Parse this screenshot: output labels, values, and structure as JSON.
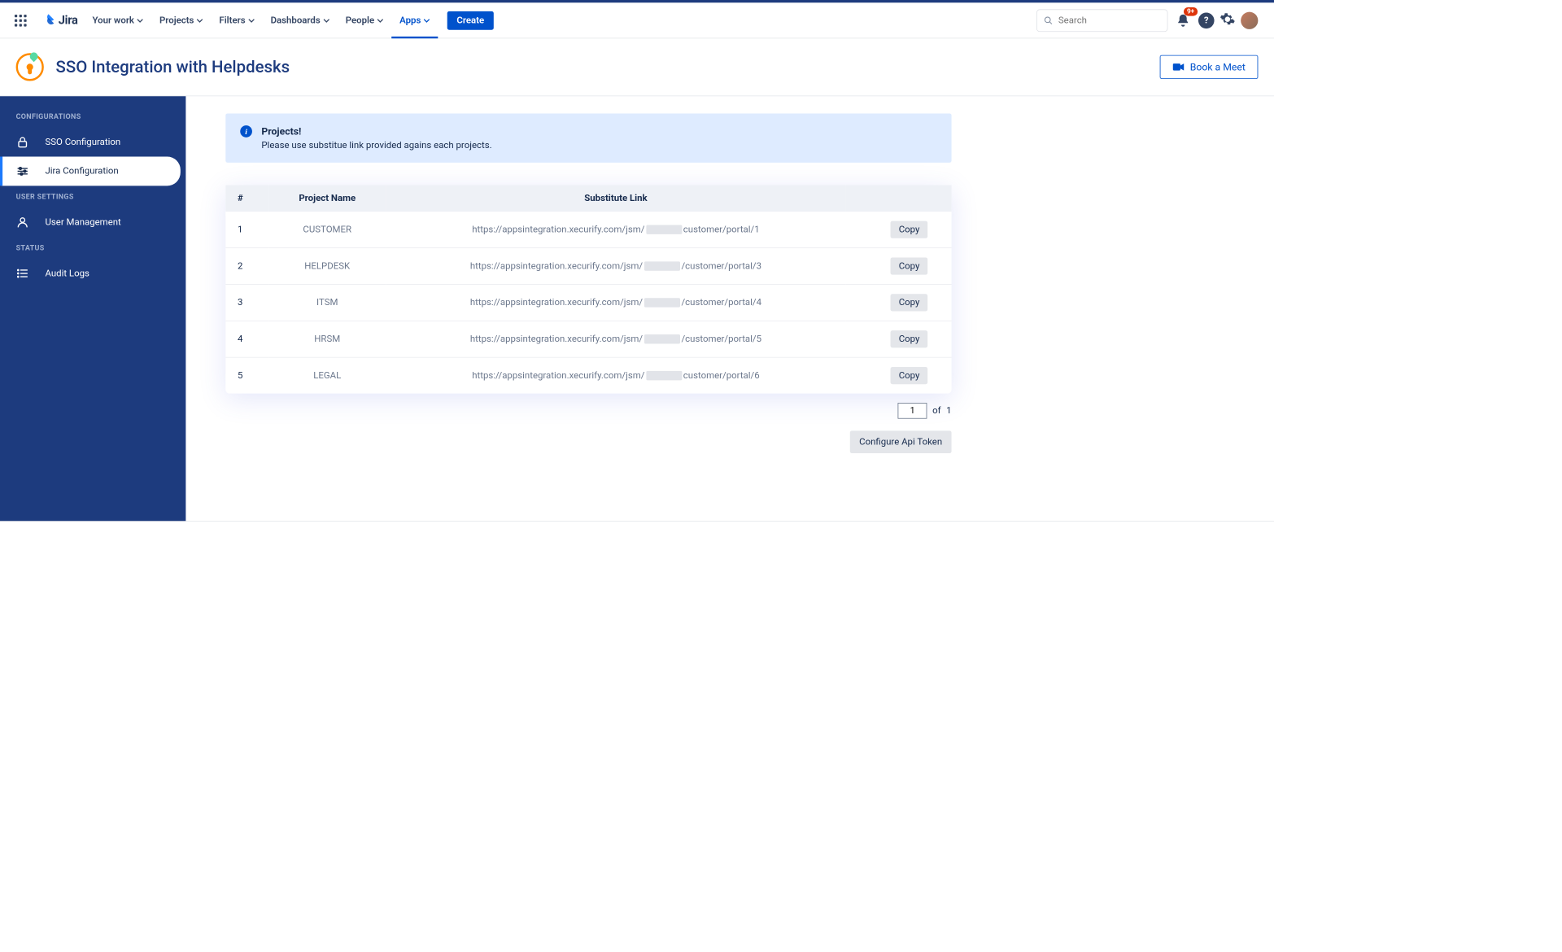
{
  "nav": {
    "logo_text": "Jira",
    "items": [
      "Your work",
      "Projects",
      "Filters",
      "Dashboards",
      "People",
      "Apps"
    ],
    "active_index": 5,
    "create_label": "Create",
    "search_placeholder": "Search",
    "notif_badge": "9+"
  },
  "header": {
    "title": "SSO Integration with Helpdesks",
    "book_label": "Book a Meet"
  },
  "sidebar": {
    "groups": [
      {
        "heading": "CONFIGURATIONS",
        "items": [
          {
            "label": "SSO Configuration",
            "icon": "lock"
          },
          {
            "label": "Jira Configuration",
            "icon": "sliders",
            "active": true
          }
        ]
      },
      {
        "heading": "USER SETTINGS",
        "items": [
          {
            "label": "User Management",
            "icon": "user"
          }
        ]
      },
      {
        "heading": "STATUS",
        "items": [
          {
            "label": "Audit Logs",
            "icon": "list"
          }
        ]
      }
    ]
  },
  "banner": {
    "title": "Projects!",
    "body": "Please use substitue link provided agains each projects."
  },
  "table": {
    "headers": [
      "#",
      "Project Name",
      "Substitute Link",
      ""
    ],
    "link_prefix": "https://appsintegration.xecurify.com/jsm/",
    "copy_label": "Copy",
    "rows": [
      {
        "n": "1",
        "name": "CUSTOMER",
        "suffix": "customer/portal/1"
      },
      {
        "n": "2",
        "name": "HELPDESK",
        "suffix": "/customer/portal/3"
      },
      {
        "n": "3",
        "name": "ITSM",
        "suffix": "/customer/portal/4"
      },
      {
        "n": "4",
        "name": "HRSM",
        "suffix": "/customer/portal/5"
      },
      {
        "n": "5",
        "name": "LEGAL",
        "suffix": "customer/portal/6"
      }
    ]
  },
  "pager": {
    "current": "1",
    "of_label": "of",
    "total": "1"
  },
  "configure_label": "Configure Api Token"
}
